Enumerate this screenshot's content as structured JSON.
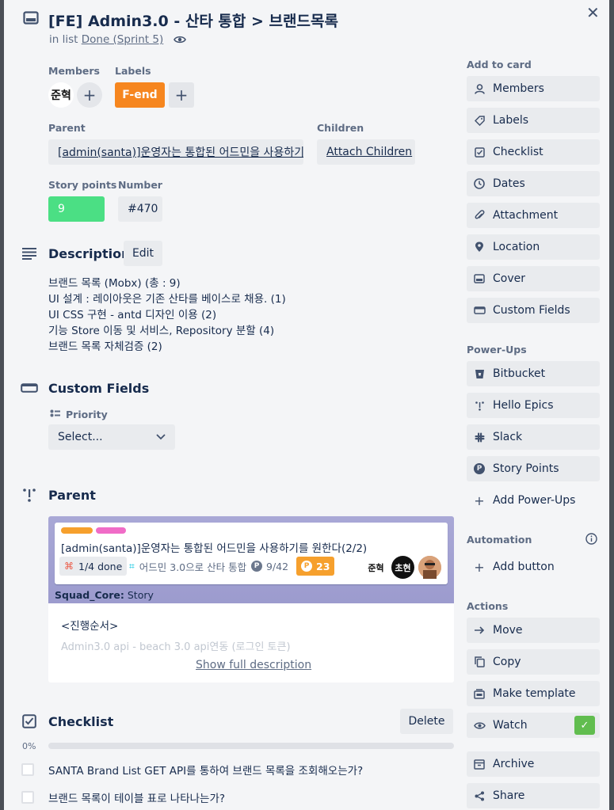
{
  "card": {
    "title": "[FE] Admin3.0 - 산타 통합 > 브랜드목록",
    "in_list_prefix": "in list",
    "list_name": "Done (Sprint 5)"
  },
  "fields": {
    "members_label": "Members",
    "member_avatar_text": "준혁",
    "labels_label": "Labels",
    "label_name": "F-end",
    "parent_label": "Parent",
    "parent_value": "[admin(santa)]운영자는 통합된 어드민을 사용하기...",
    "children_label": "Children",
    "attach_children": "Attach Children",
    "story_points_label": "Story points",
    "story_points_value": "9",
    "number_label": "Number",
    "number_value": "#470"
  },
  "description": {
    "title": "Description",
    "edit_label": "Edit",
    "lines": [
      "브랜드 목록 (Mobx) (총 : 9)",
      "UI 설계 : 레이아웃은 기존 산타를 베이스로 채용. (1)",
      "UI CSS 구현 - antd 디자인 이용 (2)",
      "기능 Store 이동 및 서비스, Repository 분할 (4)",
      "브랜드 목록 자체검증 (2)"
    ]
  },
  "custom_fields": {
    "title": "Custom Fields",
    "priority_label": "Priority",
    "select_placeholder": "Select..."
  },
  "parent_section": {
    "title": "Parent",
    "card_title": "[admin(santa)]운영자는 통합된 어드민을 사용하기를 원한다(2/2)",
    "checklist_chip": "1/4 done",
    "board_chip": "어드민 3.0으로 산타 통합",
    "points_chip": "9/42",
    "points_badge": "23",
    "avatar1": "준혁",
    "avatar2": "초현",
    "squad_label": "Squad_Core:",
    "squad_value": "Story",
    "desc_heading": "<진행순서>",
    "desc_faded": "Admin3.0 api - beach 3.0 api연동 (로그인 토큰)",
    "show_full": "Show full description"
  },
  "checklist": {
    "title": "Checklist",
    "delete_label": "Delete",
    "percent": "0%",
    "progress": 0,
    "items": [
      "SANTA Brand List GET API를 통하여 브랜드 목록을 조회해오는가?",
      "브랜드 목록이 테이블 표로 나타나는가?"
    ]
  },
  "sidebar": {
    "add_to_card": "Add to card",
    "add_items": [
      {
        "label": "Members",
        "icon": "person-icon"
      },
      {
        "label": "Labels",
        "icon": "tag-icon"
      },
      {
        "label": "Checklist",
        "icon": "checkbox-icon"
      },
      {
        "label": "Dates",
        "icon": "clock-icon"
      },
      {
        "label": "Attachment",
        "icon": "paperclip-icon"
      },
      {
        "label": "Location",
        "icon": "location-pin-icon"
      },
      {
        "label": "Cover",
        "icon": "cover-icon"
      },
      {
        "label": "Custom Fields",
        "icon": "custom-fields-icon"
      }
    ],
    "power_ups": "Power-Ups",
    "power_items": [
      {
        "label": "Bitbucket",
        "icon": "bitbucket-icon"
      },
      {
        "label": "Hello Epics",
        "icon": "hello-epics-icon"
      },
      {
        "label": "Slack",
        "icon": "slack-icon"
      },
      {
        "label": "Story Points",
        "icon": "story-points-icon"
      }
    ],
    "add_power_ups": "Add Power-Ups",
    "automation": "Automation",
    "add_button": "Add button",
    "actions": "Actions",
    "action_items": [
      {
        "label": "Move",
        "icon": "arrow-right-icon"
      },
      {
        "label": "Copy",
        "icon": "copy-icon"
      },
      {
        "label": "Make template",
        "icon": "template-icon"
      },
      {
        "label": "Watch",
        "icon": "eye-icon"
      },
      {
        "label": "Archive",
        "icon": "archive-icon"
      },
      {
        "label": "Share",
        "icon": "share-icon"
      }
    ]
  },
  "colors": {
    "label_orange": "#f6861f",
    "story_points_green": "#4bdf84",
    "watch_green": "#61bd4f",
    "points_badge_orange": "#f6a02d",
    "parent_cover": "#a9a8d6"
  }
}
